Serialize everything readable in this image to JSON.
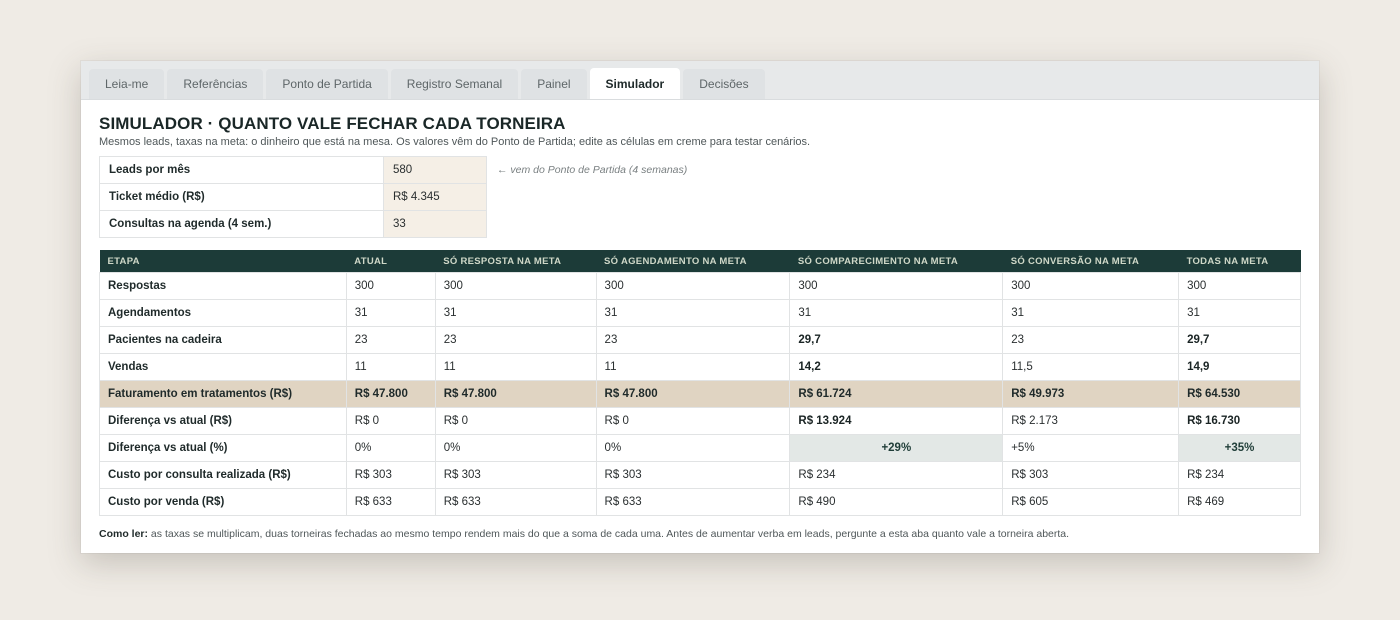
{
  "tabs": [
    "Leia-me",
    "Referências",
    "Ponto de Partida",
    "Registro Semanal",
    "Painel",
    "Simulador",
    "Decisões"
  ],
  "active_tab": "Simulador",
  "title": "SIMULADOR · QUANTO VALE FECHAR CADA TORNEIRA",
  "subtitle": "Mesmos leads, taxas na meta: o dinheiro que está na mesa. Os valores vêm do Ponto de Partida; edite as células em creme para testar cenários.",
  "inputs": [
    {
      "label": "Leads por mês",
      "value": "580"
    },
    {
      "label": "Ticket médio (R$)",
      "value": "R$ 4.345"
    },
    {
      "label": "Consultas na agenda (4 sem.)",
      "value": "33"
    }
  ],
  "inputs_note": "← vem do Ponto de Partida (4 semanas)",
  "table": {
    "headers": [
      "ETAPA",
      "ATUAL",
      "SÓ RESPOSTA NA META",
      "SÓ AGENDAMENTO NA META",
      "SÓ COMPARECIMENTO NA META",
      "SÓ CONVERSÃO NA META",
      "TODAS NA META"
    ],
    "rows": [
      {
        "label": "Respostas",
        "cells": [
          "300",
          "300",
          "300",
          "300",
          "300",
          "300"
        ]
      },
      {
        "label": "Agendamentos",
        "cells": [
          "31",
          "31",
          "31",
          "31",
          "31",
          "31"
        ]
      },
      {
        "label": "Pacientes na cadeira",
        "cells": [
          "23",
          "23",
          "23",
          "29,7",
          "23",
          "29,7"
        ]
      },
      {
        "label": "Vendas",
        "cells": [
          "11",
          "11",
          "11",
          "14,2",
          "11,5",
          "14,9"
        ]
      },
      {
        "label": "Faturamento em tratamentos (R$)",
        "cells": [
          "R$ 47.800",
          "R$ 47.800",
          "R$ 47.800",
          "R$ 61.724",
          "R$ 49.973",
          "R$ 64.530"
        ]
      },
      {
        "label": "Diferença vs atual (R$)",
        "cells": [
          "R$ 0",
          "R$ 0",
          "R$ 0",
          "R$ 13.924",
          "R$ 2.173",
          "R$ 16.730"
        ]
      },
      {
        "label": "Diferença vs atual (%)",
        "cells": [
          "0%",
          "0%",
          "0%",
          "+29%",
          "+5%",
          "+35%"
        ]
      },
      {
        "label": "Custo por consulta realizada (R$)",
        "cells": [
          "R$ 303",
          "R$ 303",
          "R$ 303",
          "R$ 234",
          "R$ 303",
          "R$ 234"
        ]
      },
      {
        "label": "Custo por venda (R$)",
        "cells": [
          "R$ 633",
          "R$ 633",
          "R$ 633",
          "R$ 490",
          "R$ 605",
          "R$ 469"
        ]
      }
    ]
  },
  "footer": {
    "lead": "Como ler:",
    "text": " as taxas se multiplicam, duas torneiras fechadas ao mesmo tempo rendem mais do que a soma de cada uma. Antes de aumentar verba em leads, pergunte a esta aba quanto vale a torneira aberta."
  },
  "colors": {
    "header_bg": "#1c3b38",
    "input_cell_bg": "#f5efe6",
    "highlight_row_bg": "#e0d4c2",
    "positive_cell_bg": "#e3e8e6"
  }
}
